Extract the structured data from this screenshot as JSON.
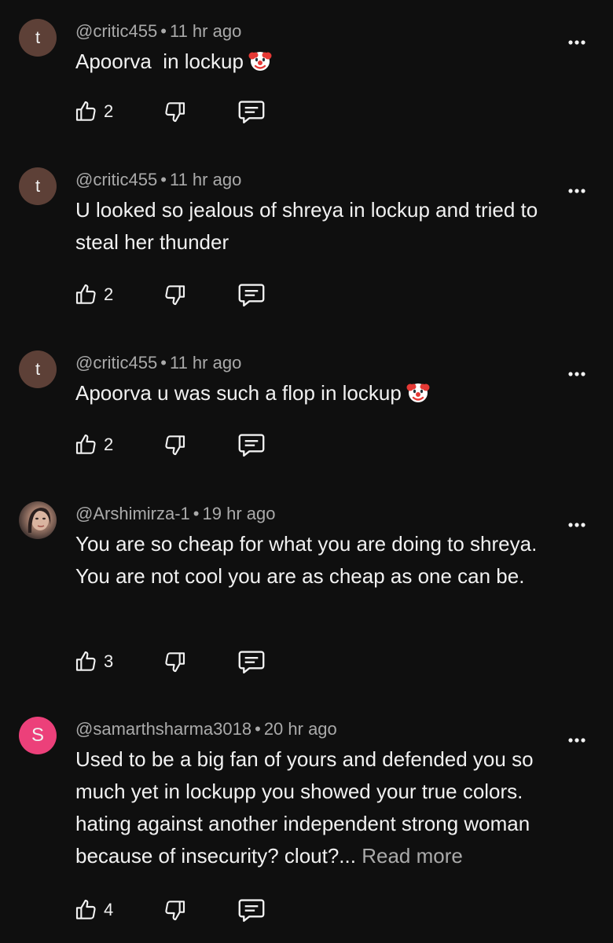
{
  "comments": [
    {
      "avatar_letter": "t",
      "handle": "@critic455",
      "separator": "•",
      "time": "11 hr ago",
      "text": "Apoorva  in lockup",
      "emoji": "clown-face",
      "read_more": "",
      "likes": "2"
    },
    {
      "avatar_letter": "t",
      "handle": "@critic455",
      "separator": "•",
      "time": "11 hr ago",
      "text": "U looked so jealous of shreya in lockup and tried to steal her thunder",
      "emoji": "",
      "read_more": "",
      "likes": "2"
    },
    {
      "avatar_letter": "t",
      "handle": "@critic455",
      "separator": "•",
      "time": "11 hr ago",
      "text": "Apoorva u was such a flop in lockup",
      "emoji": "clown-face",
      "read_more": "",
      "likes": "2"
    },
    {
      "avatar_letter": "",
      "handle": "@Arshimirza-1",
      "separator": "•",
      "time": "19 hr ago",
      "text": "You are so cheap for what you are doing to shreya. You are not cool you are as cheap as one can be.",
      "emoji": "",
      "read_more": "",
      "likes": "3"
    },
    {
      "avatar_letter": "S",
      "handle": "@samarthsharma3018",
      "separator": "•",
      "time": "20 hr ago",
      "text": "Used to be a big fan of yours and defended you so much yet in lockupp you showed your true colors. hating against another independent strong woman because of insecurity? clout?...",
      "emoji": "",
      "read_more": "Read more",
      "likes": "4"
    }
  ],
  "icons": {
    "like": "thumbs-up-icon",
    "dislike": "thumbs-down-icon",
    "reply": "reply-comment-icon",
    "more": "more-vertical-icon"
  },
  "colors": {
    "background": "#0f0f0f",
    "text_primary": "#f1f1f1",
    "text_secondary": "#aaaaaa",
    "avatar_brown": "#5d4037",
    "avatar_pink": "#ec407a"
  }
}
